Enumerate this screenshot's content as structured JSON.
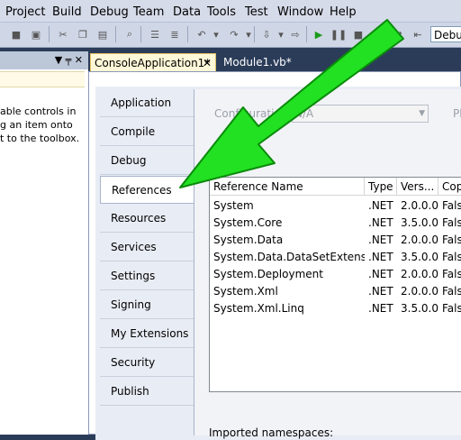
{
  "menu": {
    "items": [
      "Project",
      "Build",
      "Debug",
      "Team",
      "Data",
      "Tools",
      "Test",
      "Window",
      "Help"
    ]
  },
  "toolbar": {
    "config_value": "Debug"
  },
  "toolbox": {
    "pin_glyph": "▼ ╤ ✕",
    "help_text": "able controls in\ng an item onto\nt to the toolbox."
  },
  "tabs": [
    {
      "label": "ConsoleApplication1*",
      "close": "✕"
    },
    {
      "label": "Module1.vb*"
    }
  ],
  "sidebar": {
    "items": [
      {
        "label": "Application"
      },
      {
        "label": "Compile"
      },
      {
        "label": "Debug"
      },
      {
        "label": "References"
      },
      {
        "label": "Resources"
      },
      {
        "label": "Services"
      },
      {
        "label": "Settings"
      },
      {
        "label": "Signing"
      },
      {
        "label": "My Extensions"
      },
      {
        "label": "Security"
      },
      {
        "label": "Publish"
      }
    ],
    "active_index": 3
  },
  "configuration": {
    "label": "Configuration:",
    "value": "N/A",
    "platform_label": "Pl"
  },
  "references": {
    "columns": [
      "Reference Name",
      "Type",
      "Vers...",
      "Cop"
    ],
    "rows": [
      {
        "name": "System",
        "type": ".NET",
        "version": "2.0.0.0",
        "copy": "Fals"
      },
      {
        "name": "System.Core",
        "type": ".NET",
        "version": "3.5.0.0",
        "copy": "Fals"
      },
      {
        "name": "System.Data",
        "type": ".NET",
        "version": "2.0.0.0",
        "copy": "Fals"
      },
      {
        "name": "System.Data.DataSetExtensions",
        "type": ".NET",
        "version": "3.5.0.0",
        "copy": "Fals"
      },
      {
        "name": "System.Deployment",
        "type": ".NET",
        "version": "2.0.0.0",
        "copy": "Fals"
      },
      {
        "name": "System.Xml",
        "type": ".NET",
        "version": "2.0.0.0",
        "copy": "Fals"
      },
      {
        "name": "System.Xml.Linq",
        "type": ".NET",
        "version": "3.5.0.0",
        "copy": "Fals"
      }
    ]
  },
  "imported_namespaces_label": "Imported namespaces:",
  "colors": {
    "annotation_arrow": "#22e022",
    "annotation_arrow_outline": "#0a8a0a"
  }
}
